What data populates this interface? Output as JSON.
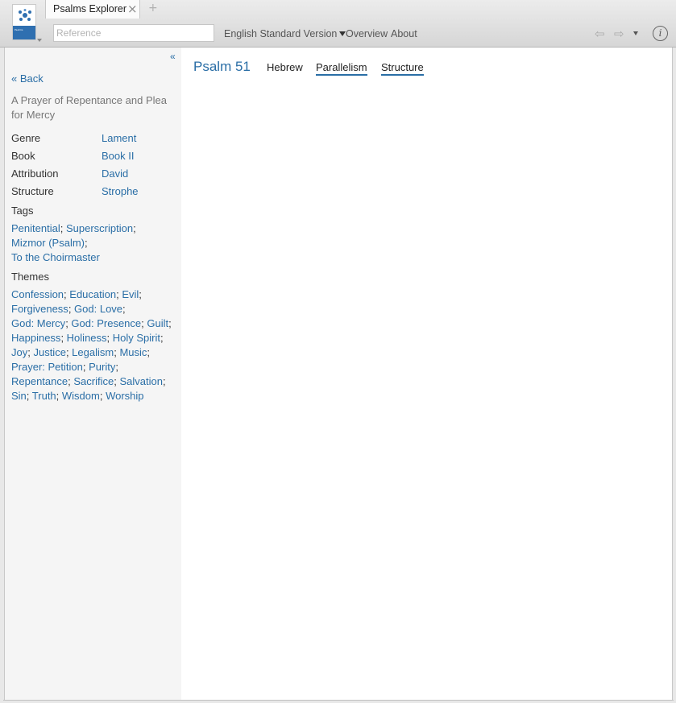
{
  "tab": {
    "title": "Psalms Explorer",
    "close": "×",
    "add": "+"
  },
  "app_icon": {
    "label_line1": "Psalms",
    "label_line2": "Explorer"
  },
  "toolbar": {
    "reference_placeholder": "Reference",
    "version": "English Standard Version",
    "overview": "Overview",
    "about": "About",
    "back_arrow": "⇦",
    "forward_arrow": "⇨",
    "info": "i"
  },
  "sidebar": {
    "collapse": "«",
    "back": "« Back",
    "subtitle": "A Prayer of Repentance and Plea for Mercy",
    "properties": [
      {
        "label": "Genre",
        "value": "Lament"
      },
      {
        "label": "Book",
        "value": "Book II"
      },
      {
        "label": "Attribution",
        "value": "David"
      },
      {
        "label": "Structure",
        "value": "Strophe"
      }
    ],
    "tags_heading": "Tags",
    "tags_lines": [
      [
        "Penitential",
        "Superscription"
      ],
      [
        "Mizmor (Psalm)"
      ],
      [
        "To the Choirmaster"
      ]
    ],
    "themes_heading": "Themes",
    "themes_lines": [
      [
        "Confession",
        "Education",
        "Evil"
      ],
      [
        "Forgiveness",
        "God: Love"
      ],
      [
        "God: Mercy",
        "God: Presence",
        "Guilt"
      ],
      [
        "Happiness",
        "Holiness",
        "Holy Spirit"
      ],
      [
        "Joy",
        "Justice",
        "Legalism",
        "Music"
      ],
      [
        "Prayer: Petition",
        "Purity"
      ],
      [
        "Repentance",
        "Sacrifice",
        "Salvation"
      ],
      [
        "Sin",
        "Truth",
        "Wisdom",
        "Worship"
      ]
    ]
  },
  "main": {
    "title": "Psalm 51",
    "tabs": [
      "Hebrew",
      "Parallelism",
      "Structure"
    ]
  },
  "colors": {
    "link": "#2a6ea6",
    "sidebar_bg": "#f5f5f5"
  }
}
